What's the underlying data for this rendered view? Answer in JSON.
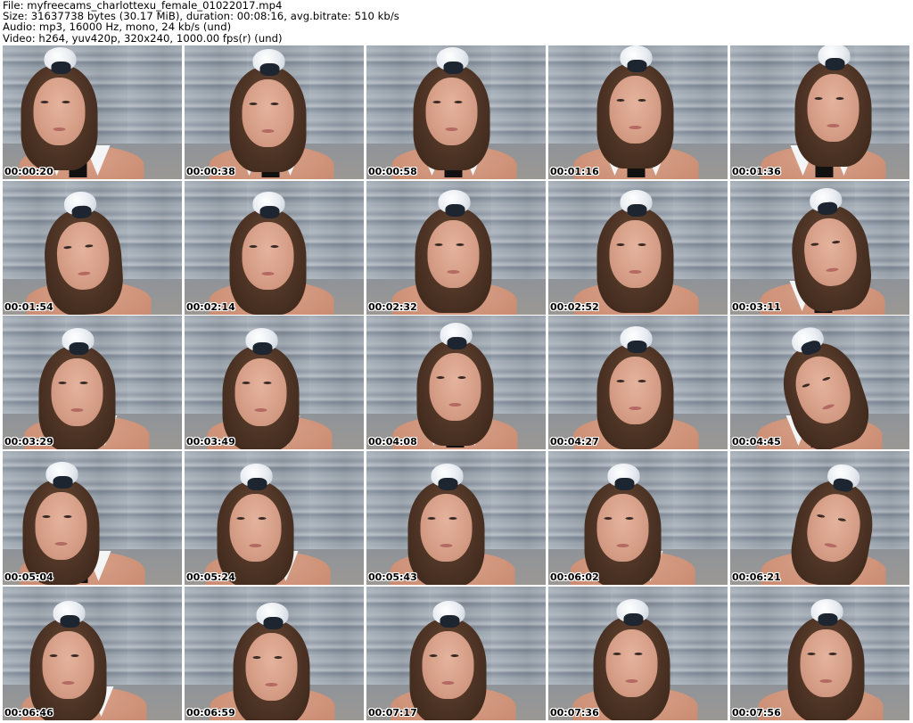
{
  "header": {
    "file_line": "File: myfreecams_charlottexu_female_01022017.mp4",
    "size_line": "Size: 31637738 bytes (30.17 MiB), duration: 00:08:16, avg.bitrate: 510 kb/s",
    "audio_line": "Audio: mp3, 16000 Hz, mono, 24 kb/s (und)",
    "video_line": "Video: h264, yuv420p, 320x240, 1000.00 fps(r) (und)"
  },
  "thumbnails": [
    {
      "timestamp": "00:00:20"
    },
    {
      "timestamp": "00:00:38"
    },
    {
      "timestamp": "00:00:58"
    },
    {
      "timestamp": "00:01:16"
    },
    {
      "timestamp": "00:01:36"
    },
    {
      "timestamp": "00:01:54"
    },
    {
      "timestamp": "00:02:14"
    },
    {
      "timestamp": "00:02:32"
    },
    {
      "timestamp": "00:02:52"
    },
    {
      "timestamp": "00:03:11"
    },
    {
      "timestamp": "00:03:29"
    },
    {
      "timestamp": "00:03:49"
    },
    {
      "timestamp": "00:04:08"
    },
    {
      "timestamp": "00:04:27"
    },
    {
      "timestamp": "00:04:45"
    },
    {
      "timestamp": "00:05:04"
    },
    {
      "timestamp": "00:05:24"
    },
    {
      "timestamp": "00:05:43"
    },
    {
      "timestamp": "00:06:02"
    },
    {
      "timestamp": "00:06:21"
    },
    {
      "timestamp": "00:06:46"
    },
    {
      "timestamp": "00:06:59"
    },
    {
      "timestamp": "00:07:17"
    },
    {
      "timestamp": "00:07:36"
    },
    {
      "timestamp": "00:07:56"
    }
  ]
}
